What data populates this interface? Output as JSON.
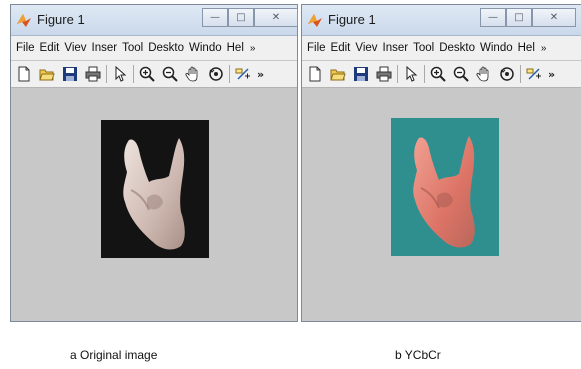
{
  "windows": [
    {
      "title": "Figure 1",
      "menu": [
        "File",
        "Edit",
        "Viev",
        "Inser",
        "Tool",
        "Deskto",
        "Windo",
        "Hel"
      ],
      "menu_more": "»",
      "toolbar_more": "»",
      "image_label": "a  Original image"
    },
    {
      "title": "Figure 1",
      "menu": [
        "File",
        "Edit",
        "Viev",
        "Inser",
        "Tool",
        "Deskto",
        "Windo",
        "Hel"
      ],
      "menu_more": "»",
      "toolbar_more": "»",
      "image_label": "b YCbCr"
    }
  ],
  "caption_buttons": {
    "minimize": "—",
    "maximize": "□",
    "close": "✕"
  },
  "toolbar_icons": [
    "new-file-icon",
    "open-folder-icon",
    "save-icon",
    "print-icon",
    "pointer-icon",
    "zoom-in-icon",
    "zoom-out-icon",
    "pan-hand-icon",
    "rotate-3d-icon",
    "data-cursor-icon"
  ],
  "colors": {
    "canvas_bg": "#c8c8c8",
    "original_bg": "#131313",
    "ycbcr_bg": "#2f8f8f",
    "skin": "#d9c7c0",
    "skin_ycbcr": "#e07a6e"
  }
}
